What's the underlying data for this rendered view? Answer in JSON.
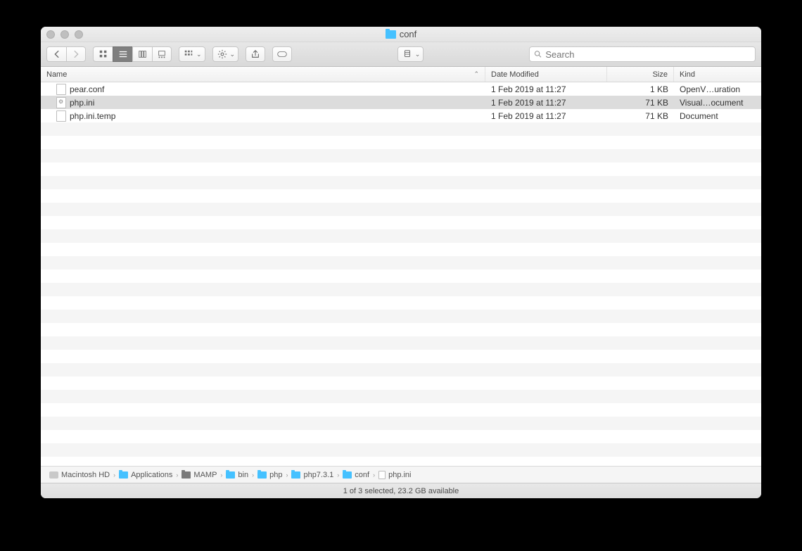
{
  "window": {
    "title": "conf",
    "folder_color": "#45c1ff"
  },
  "toolbar": {
    "search_placeholder": "Search"
  },
  "columns": {
    "name": "Name",
    "date": "Date Modified",
    "size": "Size",
    "kind": "Kind"
  },
  "files": [
    {
      "name": "pear.conf",
      "date": "1 Feb 2019 at 11:27",
      "size": "1 KB",
      "kind": "OpenV…uration",
      "selected": false,
      "icon": "doc"
    },
    {
      "name": "php.ini",
      "date": "1 Feb 2019 at 11:27",
      "size": "71 KB",
      "kind": "Visual…ocument",
      "selected": true,
      "icon": "gear"
    },
    {
      "name": "php.ini.temp",
      "date": "1 Feb 2019 at 11:27",
      "size": "71 KB",
      "kind": "Document",
      "selected": false,
      "icon": "doc"
    }
  ],
  "path": [
    {
      "label": "Macintosh HD",
      "icon": "drive"
    },
    {
      "label": "Applications",
      "icon": "folder"
    },
    {
      "label": "MAMP",
      "icon": "folder-dark"
    },
    {
      "label": "bin",
      "icon": "folder"
    },
    {
      "label": "php",
      "icon": "folder"
    },
    {
      "label": "php7.3.1",
      "icon": "folder"
    },
    {
      "label": "conf",
      "icon": "folder"
    },
    {
      "label": "php.ini",
      "icon": "file"
    }
  ],
  "status": "1 of 3 selected, 23.2 GB available"
}
